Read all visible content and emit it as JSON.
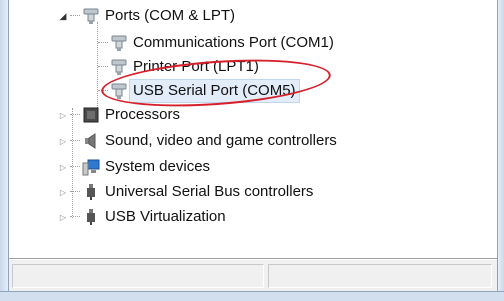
{
  "tree": {
    "items": [
      {
        "label": "Ports (COM & LPT)",
        "icon": "port-icon",
        "expanded": true
      },
      {
        "label": "Communications Port (COM1)",
        "icon": "port-icon"
      },
      {
        "label": "Printer Port (LPT1)",
        "icon": "port-icon"
      },
      {
        "label": "USB Serial Port (COM5)",
        "icon": "port-icon",
        "selected": true
      },
      {
        "label": "Processors",
        "icon": "processor-icon"
      },
      {
        "label": "Sound, video and game controllers",
        "icon": "speaker-icon"
      },
      {
        "label": "System devices",
        "icon": "computer-icon"
      },
      {
        "label": "Universal Serial Bus controllers",
        "icon": "usb-plug-icon"
      },
      {
        "label": "USB Virtualization",
        "icon": "usb-plug-icon"
      }
    ]
  },
  "colors": {
    "highlight": "#d5202a",
    "selection_background": "#e3edf9"
  }
}
